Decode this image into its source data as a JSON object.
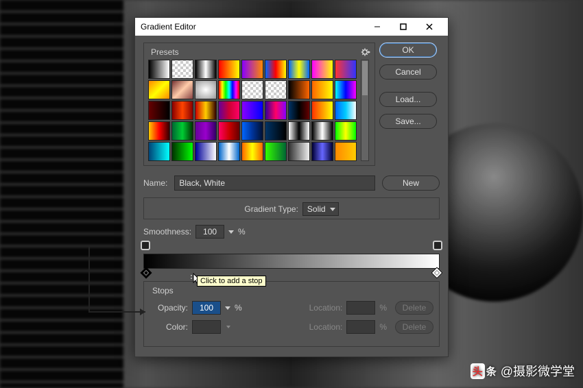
{
  "window": {
    "title": "Gradient Editor"
  },
  "buttons": {
    "ok": "OK",
    "cancel": "Cancel",
    "load": "Load...",
    "save": "Save...",
    "new": "New",
    "delete": "Delete"
  },
  "presets": {
    "label": "Presets",
    "swatches": [
      "linear-gradient(90deg,#000,#fff)",
      "repeating-conic-gradient(#ccc 0 25%,#fff 0 50%) 0/8px 8px",
      "linear-gradient(90deg,#000,#fff,#000)",
      "linear-gradient(90deg,#f00,#ff0)",
      "linear-gradient(90deg,#80f,#f80)",
      "linear-gradient(90deg,#06f,#f00,#ff0)",
      "linear-gradient(90deg,#06f,#ff0,#06f)",
      "linear-gradient(90deg,#f0f,#ff0)",
      "linear-gradient(90deg,#f33,#33f)",
      "linear-gradient(135deg,#f80,#ff0,#f80)",
      "linear-gradient(135deg,#733,#fca,#844)",
      "radial-gradient(#fff,#999)",
      "linear-gradient(90deg,#f00,#ff0,#0f0,#0ff,#00f,#f0f,#f00)",
      "repeating-conic-gradient(#ccc 0 25%,#fff 0 50%) 0/8px 8px",
      "repeating-conic-gradient(#ccc 0 25%,#fff 0 50%) 0/8px 8px",
      "linear-gradient(90deg,#000,#f60)",
      "linear-gradient(90deg,#f60,#ff0)",
      "linear-gradient(90deg,#0ff,#00f,#f0f)",
      "linear-gradient(90deg,#600,#000)",
      "linear-gradient(90deg,#800,#f40,#800)",
      "linear-gradient(90deg,#c00,#fc0,#300)",
      "linear-gradient(90deg,#609,#c03,#f06)",
      "linear-gradient(90deg,#80f,#00f)",
      "linear-gradient(90deg,#309,#f06,#80f)",
      "linear-gradient(90deg,#036,#000,#600)",
      "linear-gradient(90deg,#f30,#ff0)",
      "linear-gradient(90deg,#06f,#0cf,#fff)",
      "linear-gradient(90deg,#fc0,#f00,#300)",
      "linear-gradient(90deg,#063,#0c3,#030)",
      "linear-gradient(90deg,#609,#90c,#306)",
      "linear-gradient(90deg,#f06,#c00,#600)",
      "linear-gradient(90deg,#06f,#039,#013)",
      "linear-gradient(90deg,#036,#000)",
      "linear-gradient(90deg,#fff,#000,#fff)",
      "linear-gradient(90deg,#000,#fff,#000)",
      "linear-gradient(90deg,#0f0,#ff0,#0f0)",
      "linear-gradient(90deg,#047,#0ff)",
      "linear-gradient(90deg,#030,#0f0)",
      "linear-gradient(90deg,#009,#fff)",
      "linear-gradient(90deg,#06c,#fff,#06c)",
      "linear-gradient(90deg,#f60,#ff0,#f60)",
      "linear-gradient(90deg,#3f0,#063)",
      "linear-gradient(90deg,#333,#eee)",
      "linear-gradient(90deg,#003,#66f,#003)",
      "linear-gradient(90deg,#f80,#fc0)"
    ]
  },
  "name": {
    "label": "Name:",
    "value": "Black, White"
  },
  "gradient_type": {
    "label": "Gradient Type:",
    "value": "Solid"
  },
  "smoothness": {
    "label": "Smoothness:",
    "value": "100",
    "unit": "%"
  },
  "gradient_bar": {
    "css": "linear-gradient(90deg,#000,#fff)"
  },
  "tooltip": "Click to add a stop",
  "stops": {
    "label": "Stops",
    "opacity_label": "Opacity:",
    "opacity_value": "100",
    "opacity_unit": "%",
    "location_label": "Location:",
    "location_unit": "%",
    "color_label": "Color:"
  },
  "watermark": {
    "brand": "头条",
    "handle": "@摄影微学堂"
  }
}
